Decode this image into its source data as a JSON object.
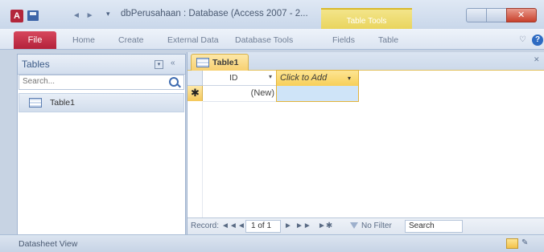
{
  "window": {
    "title": "dbPerusahaan : Database (Access 2007 - 2...",
    "contextual_tab": "Table Tools",
    "app_icon": "A"
  },
  "ribbon": {
    "tabs": [
      "File",
      "Home",
      "Create",
      "External Data",
      "Database Tools",
      "Fields",
      "Table"
    ],
    "help_glyph": "?"
  },
  "nav_pane": {
    "title": "Tables",
    "search_placeholder": "Search...",
    "items": [
      {
        "label": "Table1",
        "icon": "table-icon"
      }
    ]
  },
  "document": {
    "tab_label": "Table1",
    "columns": [
      {
        "label": "ID"
      },
      {
        "label": "Click to Add"
      }
    ],
    "new_row_marker": "✱",
    "new_row_value": "(New)"
  },
  "record_nav": {
    "record_label": "Record:",
    "first": "◄◄",
    "prev": "◄",
    "current": "1 of 1",
    "next": "►",
    "last": "►►",
    "new": "►✱",
    "filter_label": "No Filter",
    "search_label": "Search"
  },
  "status_bar": {
    "view_label": "Datasheet View"
  },
  "colors": {
    "file_tab": "#b3223a",
    "table_tools": "#e6cf4f",
    "selection": "#cfe4f8",
    "header_accent": "#f7cf5a"
  }
}
